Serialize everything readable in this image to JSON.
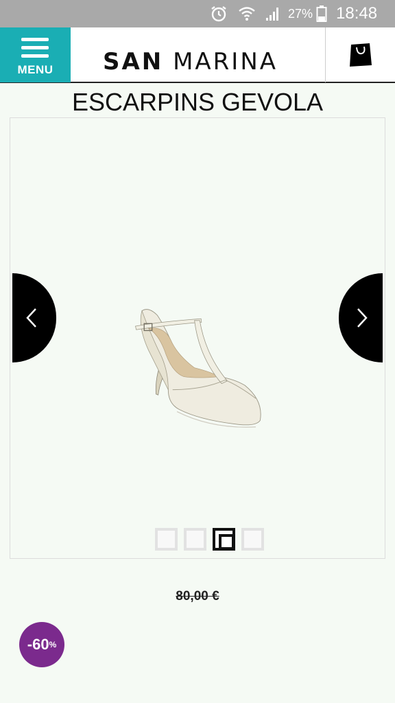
{
  "status_bar": {
    "battery_percent": "27%",
    "time": "18:48",
    "icons": [
      "alarm-icon",
      "wifi-icon",
      "signal-icon",
      "battery-icon"
    ]
  },
  "header": {
    "menu_label": "MENU",
    "brand_bold": "SAN",
    "brand_regular": "MARINA",
    "accent_color": "#1aaeb4"
  },
  "product": {
    "title": "ESCARPINS GEVOLA",
    "old_price": "80,00 €",
    "discount": "-60",
    "discount_suffix": "%",
    "discount_color": "#7b2a8d"
  },
  "gallery": {
    "image_count": 4,
    "active_index": 3,
    "shoe_brand_text": "SAN MARINA"
  }
}
